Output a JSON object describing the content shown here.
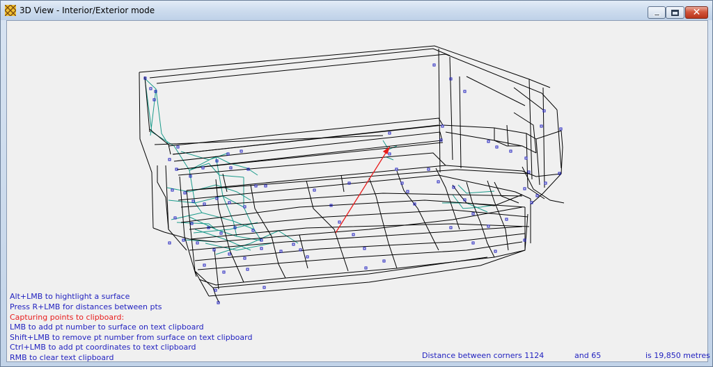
{
  "window": {
    "title": "3D View - Interior/Exterior mode",
    "icon": "app-grid-icon",
    "controls": {
      "minimize": "minimize-icon",
      "maximize": "maximize-icon",
      "close": "close-icon"
    }
  },
  "help": {
    "lines": [
      "Alt+LMB to hightlight a surface",
      "Press R+LMB for distances between pts",
      "Capturing points to clipboard:",
      "LMB to add pt number to surface on text clipboard",
      "Shift+LMB to remove pt number from surface on text clipboard",
      "Ctrl+LMB to add pt coordinates to text clipboard",
      "RMB to clear text clipboard"
    ]
  },
  "status": {
    "distance_label": "Distance between corners 1124",
    "and_label": "and 65",
    "result_label": "is 19,850 metres"
  },
  "colors": {
    "help_text": "#1f1fbf",
    "highlight_text": "#e81c1c",
    "wireframe": "#000000",
    "points": "#1f1fbf",
    "surface_mesh": "#1a9a8a",
    "measure_line": "#e81c1c"
  }
}
